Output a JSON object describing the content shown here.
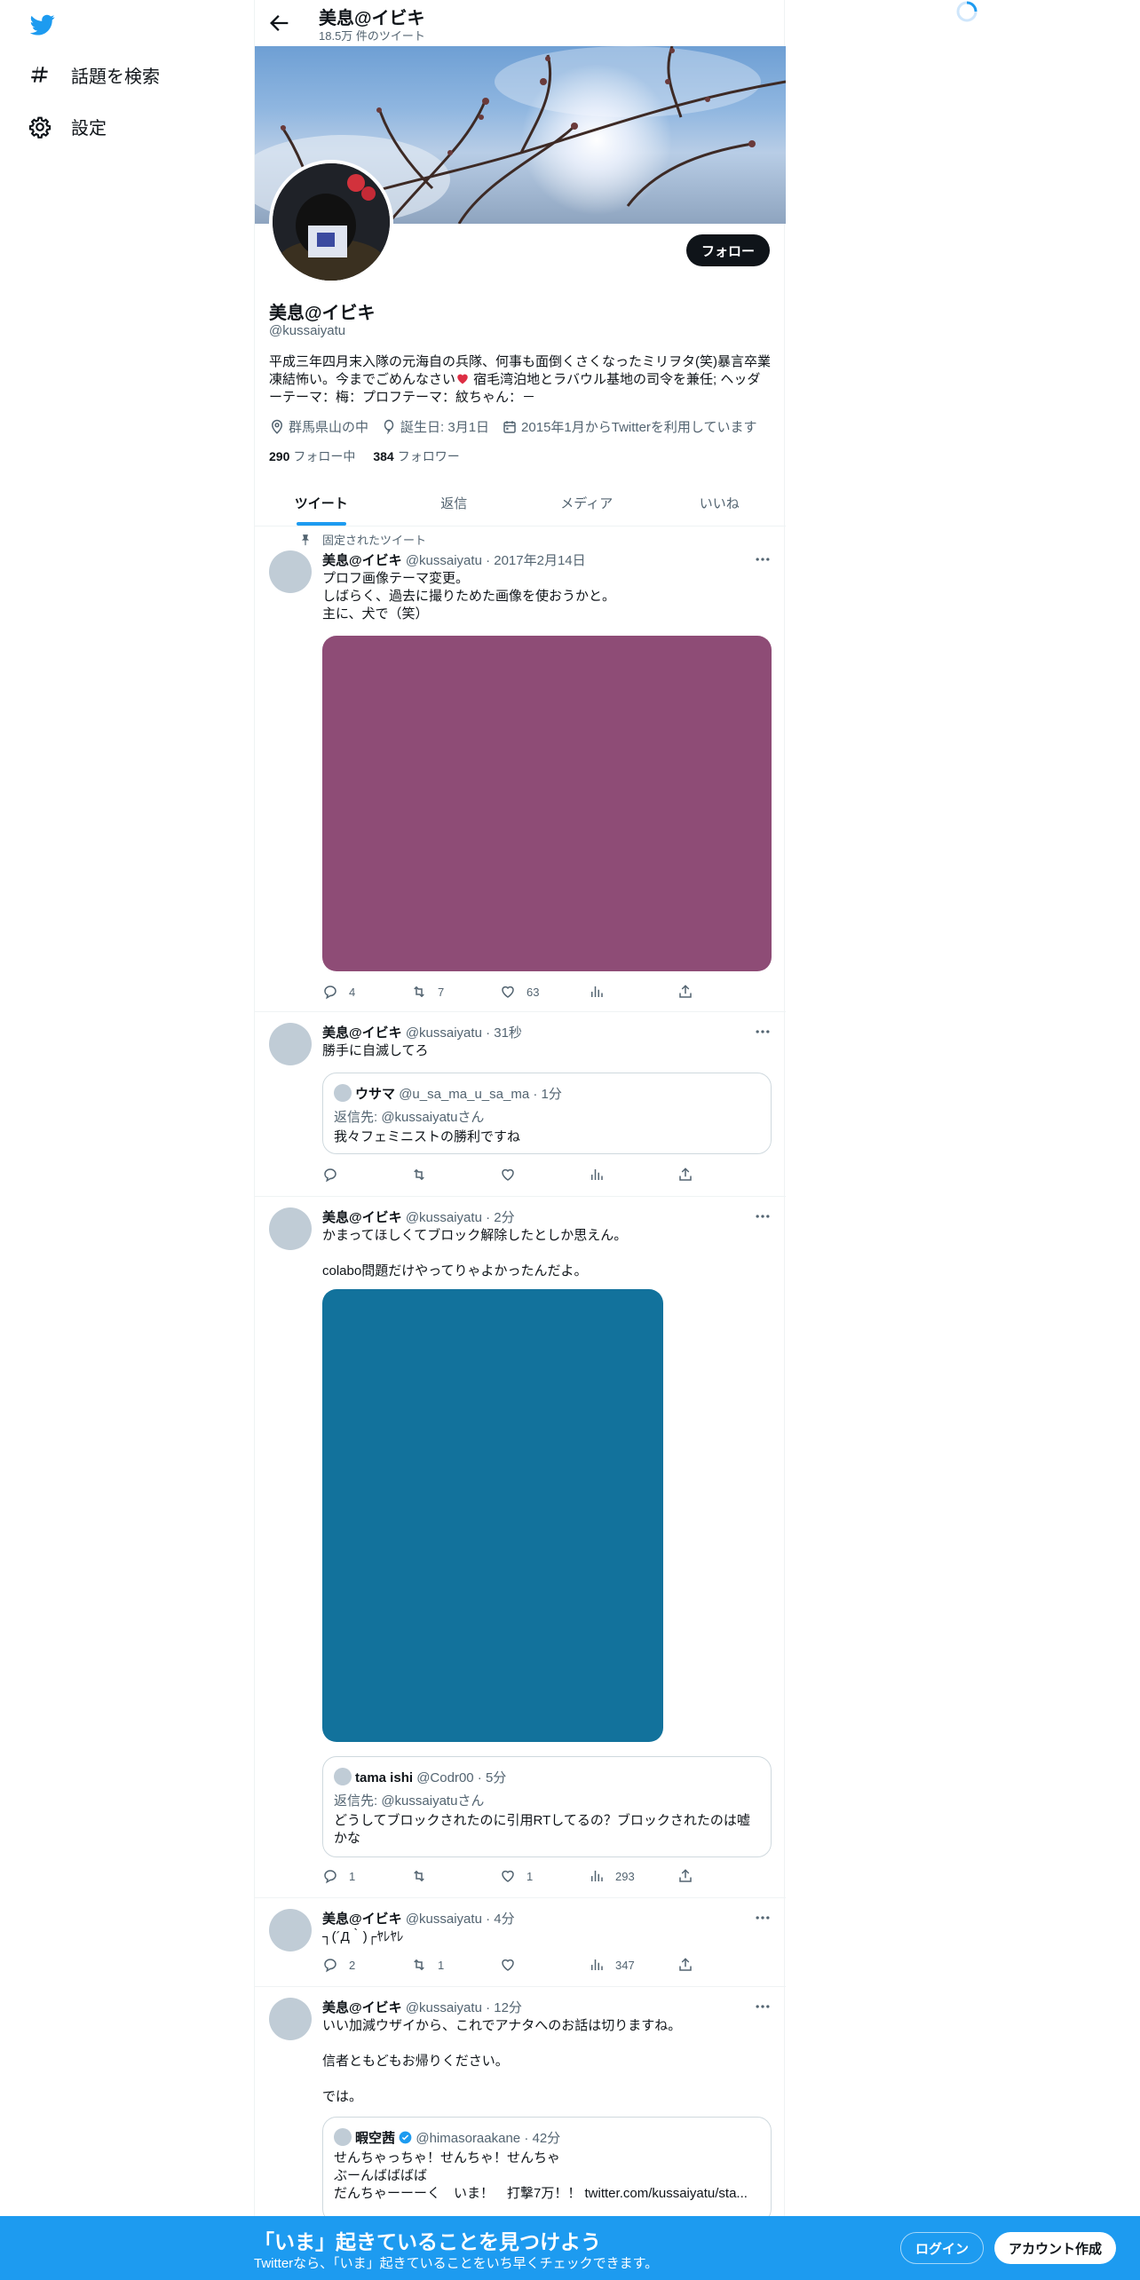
{
  "sidebar": {
    "logo": "twitter-bird-icon",
    "items": [
      {
        "label": "話題を検索",
        "icon": "hashtag-icon"
      },
      {
        "label": "設定",
        "icon": "gear-icon"
      }
    ]
  },
  "header": {
    "title": "美息@イビキ",
    "subtitle": "18.5万 件のツイート"
  },
  "profile": {
    "name": "美息@イビキ",
    "handle": "@kussaiyatu",
    "follow_label": "フォロー",
    "bio_part1": "平成三年四月末入隊の元海自の兵隊、何事も面倒くさくなったミリヲタ(笑)暴言卒業凍結怖い。今までごめんなさい",
    "bio_part2": " 宿毛湾泊地とラバウル基地の司令を兼任; ヘッダーテーマ：梅：プロフテーマ：紋ちゃん：－",
    "location": "群馬県山の中",
    "birthday": "誕生日: 3月1日",
    "joined": "2015年1月からTwitterを利用しています",
    "following_count": "290",
    "following_label": "フォロー中",
    "followers_count": "384",
    "followers_label": "フォロワー"
  },
  "tabs": [
    "ツイート",
    "返信",
    "メディア",
    "いいね"
  ],
  "pinned_label": "固定されたツイート",
  "tweets": [
    {
      "name": "美息@イビキ",
      "meta": "@kussaiyatu · 2017年2月14日",
      "text": "プロフ画像テーマ変更。\nしばらく、過去に撮りためた画像を使おうかと。\n主に、犬で（笑）",
      "media_color": "#8e4c76",
      "stats": {
        "reply": "4",
        "retweet": "7",
        "like": "63",
        "views": ""
      }
    },
    {
      "name": "美息@イビキ",
      "meta": "@kussaiyatu · 31秒",
      "text": "勝手に自滅してろ",
      "quote": {
        "name": "ウサマ",
        "meta": "@u_sa_ma_u_sa_ma · 1分",
        "reply": "返信先: @kussaiyatuさん",
        "text": "我々フェミニストの勝利ですね"
      },
      "stats": {
        "reply": "",
        "retweet": "",
        "like": "",
        "views": ""
      }
    },
    {
      "name": "美息@イビキ",
      "meta": "@kussaiyatu · 2分",
      "text": "かまってほしくてブロック解除したとしか思えん。\n\ncolabo問題だけやってりゃよかったんだよ。",
      "media_color": "#12729c",
      "quote": {
        "name": "tama ishi",
        "meta": "@Codr00 · 5分",
        "reply": "返信先: @kussaiyatuさん",
        "text": "どうしてブロックされたのに引用RTしてるの？ブロックされたのは嘘かな"
      },
      "stats": {
        "reply": "1",
        "retweet": "",
        "like": "1",
        "views": "293"
      }
    },
    {
      "name": "美息@イビキ",
      "meta": "@kussaiyatu · 4分",
      "text": "┐(´Д｀)┌ﾔﾚﾔﾚ",
      "stats": {
        "reply": "2",
        "retweet": "1",
        "like": "",
        "views": "347"
      }
    },
    {
      "name": "美息@イビキ",
      "meta": "@kussaiyatu · 12分",
      "text": "いい加減ウザイから、これでアナタへのお話は切りますね。\n\n信者ともどもお帰りください。\n\nでは。",
      "quote": {
        "name": "暇空茜",
        "meta": "@himasoraakane · 42分",
        "reply": "",
        "text": "せんちゃっちゃ！せんちゃ！せんちゃ\nぶーんばばばば\nだんちゃーーーく　いま！　打撃7万！！ twitter.com/kussaiyatu/sta..."
      }
    }
  ],
  "bottom_bar": {
    "title": "「いま」起きていることを見つけよう",
    "subtitle": "Twitterなら、「いま」起きていることをいち早くチェックできます。",
    "login": "ログイン",
    "signup": "アカウント作成"
  },
  "colors": {
    "accent": "#1d9bf0",
    "text": "#0f1419",
    "secondary": "#536471"
  }
}
